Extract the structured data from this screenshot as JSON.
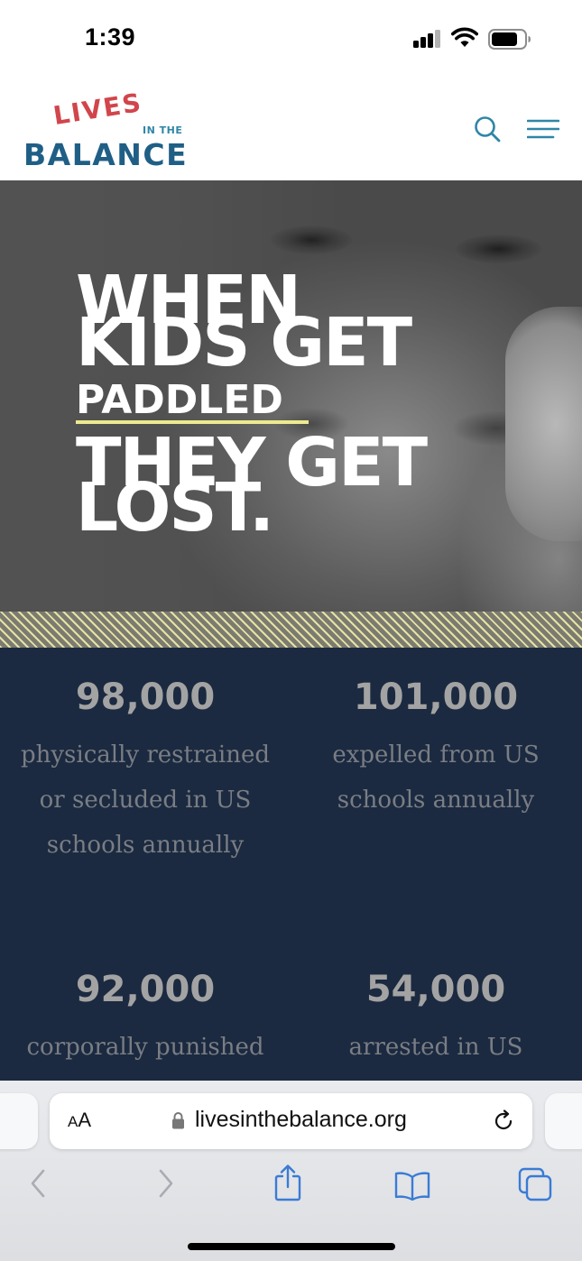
{
  "status_bar": {
    "time": "1:39"
  },
  "header": {
    "logo": {
      "line1": "LIVES",
      "line2": "IN THE",
      "line3": "BALANCE"
    }
  },
  "hero": {
    "line1": "WHEN",
    "line2": "KIDS GET",
    "line3": "PADDLED",
    "line4": "THEY GET",
    "line5": "LOST."
  },
  "stats": [
    {
      "number": "98,000",
      "text": "physically restrained or secluded in US schools annually"
    },
    {
      "number": "101,000",
      "text": "expelled from US schools annually"
    },
    {
      "number": "92,000",
      "text": "corporally punished in US"
    },
    {
      "number": "54,000",
      "text": "arrested in US schools annually"
    }
  ],
  "browser": {
    "aa_small": "A",
    "aa_big": "A",
    "url": "livesinthebalance.org"
  },
  "colors": {
    "logo_red": "#d2454b",
    "logo_blue": "#1f5f86",
    "stats_background": "#1b2a40",
    "highlight_yellow": "#ecea8f",
    "ios_blue": "#3a7bd5"
  }
}
